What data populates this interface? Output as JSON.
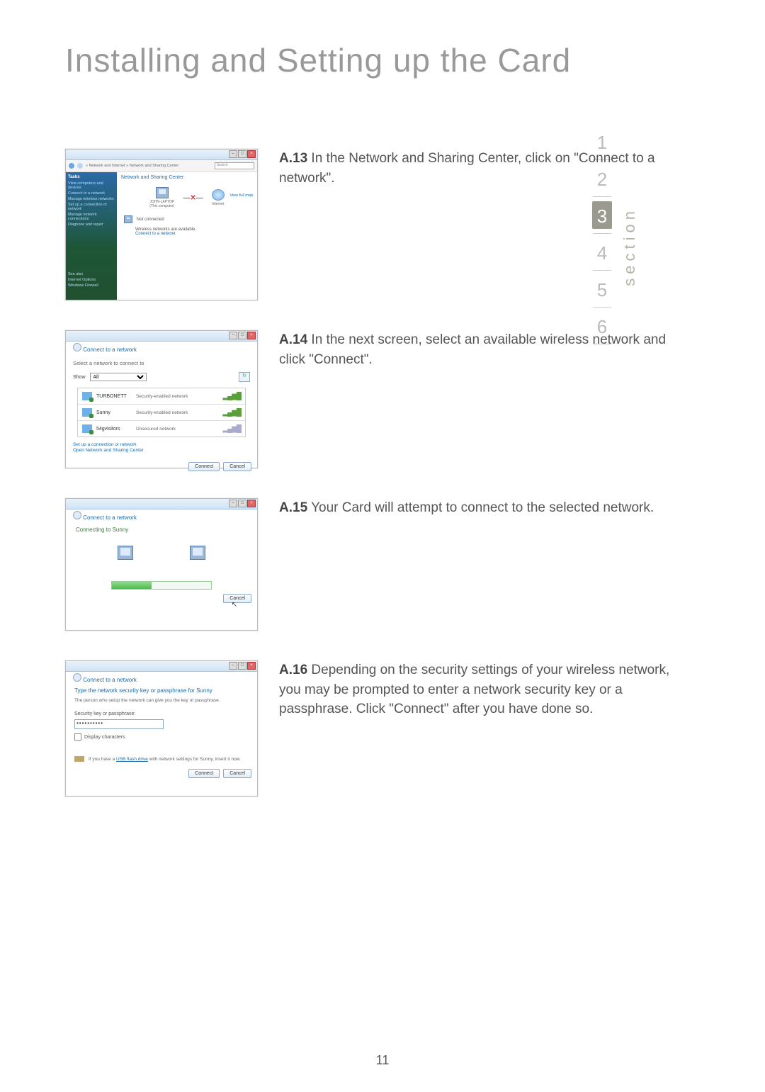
{
  "title": "Installing and Setting up the Card",
  "page_number": "11",
  "section_nav": {
    "label": "section",
    "items": [
      "1",
      "2",
      "3",
      "4",
      "5",
      "6"
    ],
    "active_index": 2
  },
  "steps": [
    {
      "label": "A.13",
      "text": " In the Network and Sharing Center, click on \"Connect to a network\"."
    },
    {
      "label": "A.14",
      "text": " In the next screen, select an available wireless network and click \"Connect\"."
    },
    {
      "label": "A.15",
      "text": " Your Card will attempt to connect to the selected network."
    },
    {
      "label": "A.16",
      "text": " Depending on the security settings of your wireless network, you may be prompted to enter a network security key or a passphrase. Click \"Connect\" after you have done so."
    }
  ],
  "shot1": {
    "breadcrumb": "« Network and Internet » Network and Sharing Center",
    "search_placeholder": "Search",
    "heading": "Network and Sharing Center",
    "view_full_map": "View full map",
    "tasks_header": "Tasks",
    "tasks": [
      "View computers and devices",
      "Connect to a network",
      "Manage wireless networks",
      "Set up a connection or network",
      "Manage network connections",
      "Diagnose and repair"
    ],
    "bottom_links": [
      "See also",
      "Internet Options",
      "Windows Firewall"
    ],
    "node_pc": "JOHN-LAPTOP",
    "node_pc_sub": "(This computer)",
    "node_net": "Internet",
    "status_icon_label": "Not connected",
    "status_line": "Wireless networks are available.",
    "status_link": "Connect to a network"
  },
  "shot2": {
    "window_title": "Connect to a network",
    "subtitle": "Select a network to connect to",
    "show_label": "Show",
    "show_value": "All",
    "networks": [
      {
        "name": "TURBONETT",
        "desc": "Security-enabled network"
      },
      {
        "name": "Sunny",
        "desc": "Security-enabled network"
      },
      {
        "name": "54gvisitors",
        "desc": "Unsecured network"
      }
    ],
    "link_setup": "Set up a connection or network",
    "link_open": "Open Network and Sharing Center",
    "btn_connect": "Connect",
    "btn_cancel": "Cancel"
  },
  "shot3": {
    "window_title": "Connect to a network",
    "message": "Connecting to Sunny",
    "btn_cancel": "Cancel"
  },
  "shot4": {
    "window_title": "Connect to a network",
    "prompt": "Type the network security key or passphrase for Sunny",
    "note": "The person who setup the network can give you the key or passphrase.",
    "field_label": "Security key or passphrase:",
    "field_value": "••••••••••",
    "checkbox_label": "Display characters",
    "usb_text_pre": "If you have a ",
    "usb_link": "USB flash drive",
    "usb_text_post": " with network settings for Sunny, insert it now.",
    "btn_connect": "Connect",
    "btn_cancel": "Cancel"
  }
}
